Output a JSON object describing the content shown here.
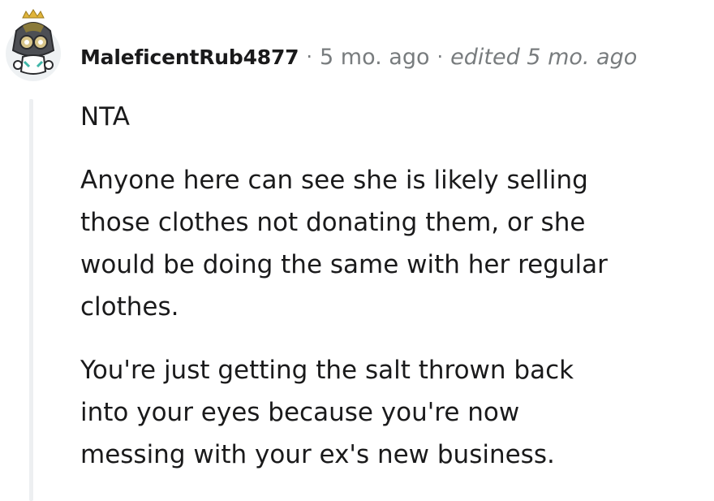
{
  "comment": {
    "avatar_icon": "snoo-avatar-icon",
    "username": "MaleficentRub4877",
    "separator": "·",
    "timestamp": "5 mo. ago",
    "edited": "edited 5 mo. ago",
    "paragraphs": [
      "NTA",
      "Anyone here can see she is likely selling\nthose clothes not donating them, or she\nwould be doing the same with her regular\nclothes.",
      "You're just getting the salt thrown back\ninto your eyes because you're now\nmessing with your ex's new business."
    ]
  },
  "colors": {
    "text": "#1a1a1b",
    "meta": "#787c7e",
    "thread_line": "#edeff1"
  }
}
